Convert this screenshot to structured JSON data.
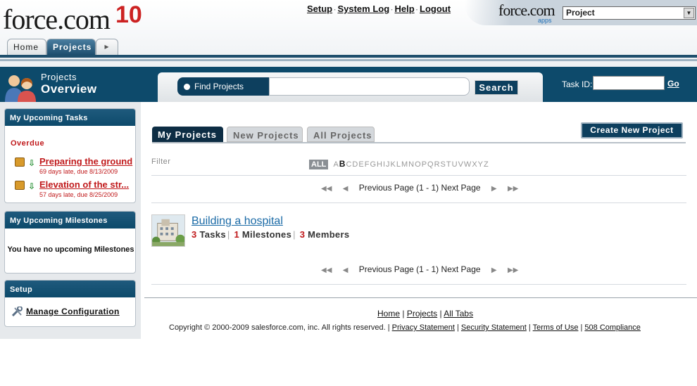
{
  "header": {
    "logo_word": "force.com",
    "logo_badge": "10",
    "top_links": [
      "Setup",
      "System Log",
      "Help",
      "Logout"
    ],
    "app_logo": "force.com",
    "app_logo_sub": "apps",
    "app_select": "Project"
  },
  "tabs": {
    "home": "Home",
    "projects": "Projects",
    "more": "▸"
  },
  "band": {
    "title_small": "Projects",
    "title_big": "Overview",
    "search_label": "Find Projects",
    "search_value": "",
    "search_button": "Search",
    "task_id_label": "Task ID:",
    "task_id_value": "",
    "go": "Go"
  },
  "sidebar": {
    "tasks_title": "My Upcoming Tasks",
    "overdue": "Overdue",
    "tasks": [
      {
        "name": "Preparing the ground",
        "meta": "69 days late, due 8/13/2009"
      },
      {
        "name": "Elevation of the str...",
        "meta": "57 days late, due 8/25/2009"
      }
    ],
    "milestones_title": "My Upcoming Milestones",
    "milestones_empty": "You have no upcoming Milestones",
    "setup_title": "Setup",
    "manage_config": "Manage Configuration"
  },
  "main": {
    "tab_my": "My Projects",
    "tab_new": "New Projects",
    "tab_all": "All Projects",
    "create_button": "Create New Project",
    "filter_label": "Filter",
    "filter_all": "ALL",
    "filter_letters": [
      "A",
      "B",
      "C",
      "D",
      "E",
      "F",
      "G",
      "H",
      "I",
      "J",
      "K",
      "L",
      "M",
      "N",
      "O",
      "P",
      "Q",
      "R",
      "S",
      "T",
      "U",
      "V",
      "W",
      "X",
      "Y",
      "Z"
    ],
    "pager": {
      "prev": "Previous Page",
      "range": "(1 - 1)",
      "next": "Next Page"
    },
    "project": {
      "name": "Building a hospital",
      "tasks_count": "3",
      "tasks_label": "Tasks",
      "milestones_count": "1",
      "milestones_label": "Milestones",
      "members_count": "3",
      "members_label": "Members"
    }
  },
  "footer": {
    "links": [
      "Home",
      "Projects",
      "All Tabs"
    ],
    "copyright": "Copyright © 2000-2009 salesforce.com, inc. All rights reserved. |",
    "legal_links": [
      "Privacy Statement",
      "Security Statement",
      "Terms of Use",
      "508 Compliance"
    ]
  }
}
